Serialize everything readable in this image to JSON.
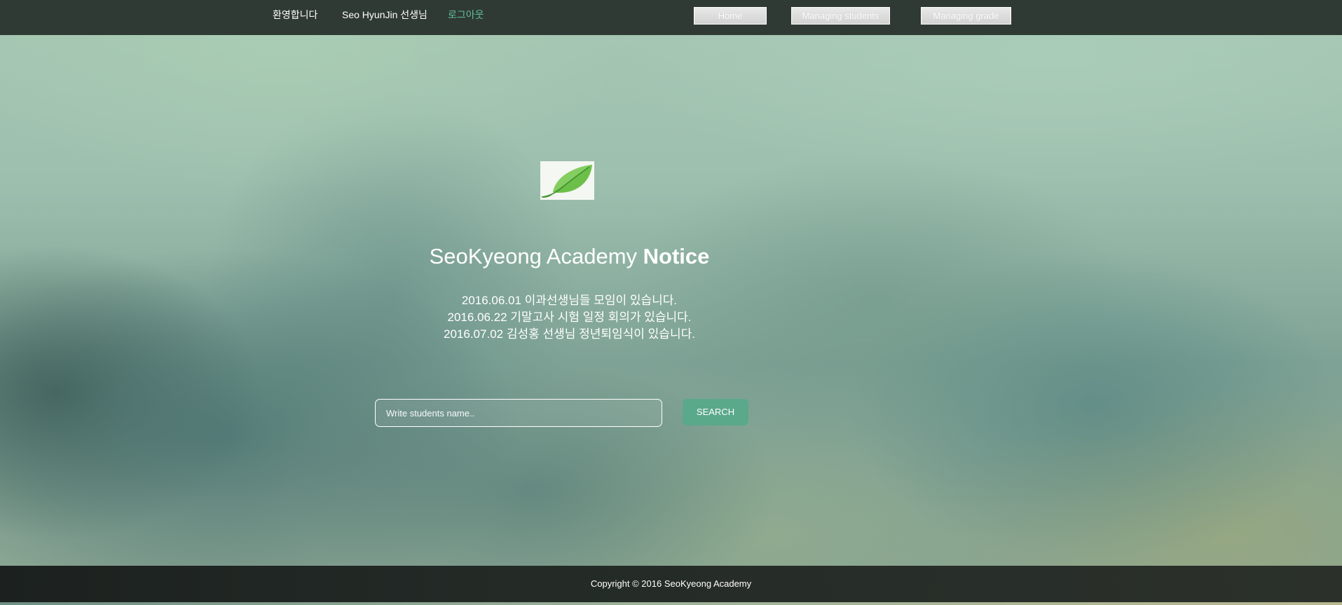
{
  "nav": {
    "welcome": "환영합니다",
    "user": "Seo HyunJin 선생님",
    "logout": "로그아웃",
    "buttons": {
      "home": "Home",
      "students": "Managing students",
      "grade": "Managing grade"
    }
  },
  "logo": {
    "icon": "leaf-icon",
    "colors": {
      "leaf": "#6cc04a",
      "leaf_dark": "#3f8f2f",
      "background": "#f4f7f2"
    }
  },
  "main": {
    "title_regular": "SeoKyeong Academy ",
    "title_bold": "Notice",
    "notices": [
      "2016.06.01 이과선생님들 모임이 있습니다.",
      "2016.06.22 기말고사 시험 일정 회의가 있습니다.",
      "2016.07.02 김성홍 선생님 정년퇴임식이 있습니다."
    ]
  },
  "search": {
    "placeholder": "Write students name..",
    "button": "SEARCH"
  },
  "footer": {
    "copyright": "Copyright © 2016 SeoKyeong Academy"
  },
  "colors": {
    "nav_bg": "#303a35",
    "accent": "#5fbf95",
    "search_button": "#5aa98a",
    "footer_bg": "#242b27"
  }
}
